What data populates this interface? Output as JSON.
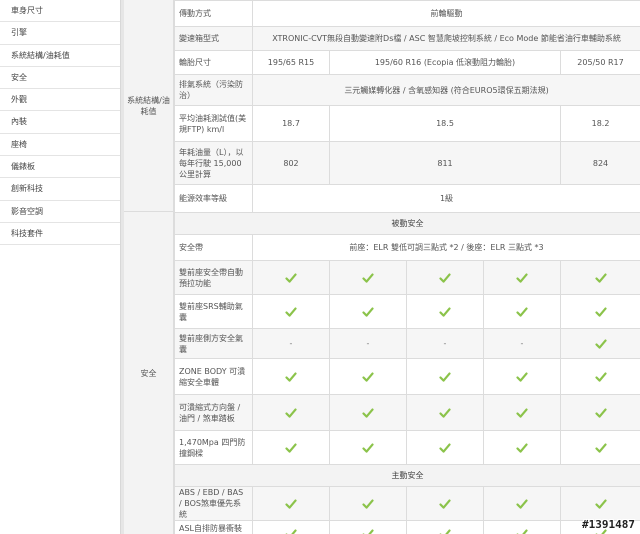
{
  "sidebar": {
    "items": [
      "車身尺寸",
      "引擎",
      "系統結構/油耗值",
      "安全",
      "外觀",
      "內裝",
      "座椅",
      "儀錶板",
      "創新科技",
      "影音空調",
      "科技套件"
    ]
  },
  "groups": {
    "system": "系統結構/油耗值",
    "safety": "安全"
  },
  "rows": {
    "drive": {
      "label": "傳動方式",
      "value": "前輪驅動"
    },
    "transmission": {
      "label": "變速箱型式",
      "value": "XTRONIC-CVT無段自動變速附Ds檔 / ASC 智慧爬坡控制系統 / Eco Mode 節能省油行車輔助系統"
    },
    "tire": {
      "label": "輪胎尺寸",
      "v1": "195/65 R15",
      "v2": "195/60 R16 (Ecopia 低滾動阻力輪胎)",
      "v3": "205/50 R17"
    },
    "emission": {
      "label": "排氣系統（污染防治）",
      "value": "三元觸媒轉化器 / 含氧感知器 (符合EURO5環保五期法規)"
    },
    "fuel": {
      "label": "平均油耗測試值(美規FTP) km/l",
      "v1": "18.7",
      "v2": "18.5",
      "v3": "18.2"
    },
    "annual": {
      "label": "年耗油量（L），以每年行駛 15,000公里計算",
      "v1": "802",
      "v2": "811",
      "v3": "824"
    },
    "efficiency": {
      "label": "能源效率等級",
      "value": "1級"
    },
    "passive_section": "被動安全",
    "seatbelt": {
      "label": "安全帶",
      "value": "前座：ELR 雙低可調三點式 *2 / 後座：ELR 三點式 *3"
    },
    "pretensioner": {
      "label": "雙前座安全帶自動預拉功能"
    },
    "front_airbag": {
      "label": "雙前座SRS輔助氣囊"
    },
    "side_airbag": {
      "label": "雙前座側方安全氣囊",
      "dash": "-"
    },
    "zone_body": {
      "label": "ZONE BODY 可潰縮安全車體"
    },
    "collapsible": {
      "label": "可潰縮式方向盤 / 油門 / 煞車踏板"
    },
    "door_beam": {
      "label": "1,470Mpa 四門防撞鋼樑"
    },
    "active_section": "主動安全",
    "abs": {
      "label": "ABS / EBD / BAS / BOS煞車優先系統"
    },
    "asl": {
      "label": "ASL自排防暴衝裝置"
    }
  },
  "watermark": "#1391487",
  "colors": {
    "check": "#8bc34a",
    "sidebar_border": "#e4e4e4",
    "section_bg": "#f3f3f3"
  },
  "icons": {
    "check": "check-icon"
  }
}
